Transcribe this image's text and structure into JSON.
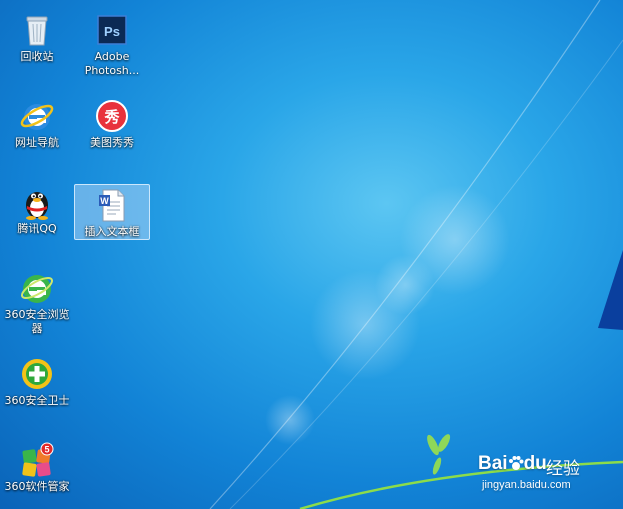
{
  "desktop": {
    "icons": [
      {
        "label": "回收站",
        "icon": "recycle-bin-icon"
      },
      {
        "label": "Adobe Photosh...",
        "icon": "photoshop-icon",
        "glyph": "Ps"
      },
      {
        "label": "网址导航",
        "icon": "internet-explorer-icon",
        "glyph": "e"
      },
      {
        "label": "美图秀秀",
        "icon": "meitu-xiuxiu-icon",
        "glyph": "秀"
      },
      {
        "label": "腾讯QQ",
        "icon": "qq-penguin-icon"
      },
      {
        "label": "插入文本框",
        "icon": "word-document-icon",
        "glyph": "W"
      },
      {
        "label": "360安全浏览器",
        "icon": "360-browser-icon",
        "glyph": "e"
      },
      {
        "label": "360安全卫士",
        "icon": "360-security-guard-icon",
        "glyph": "+"
      },
      {
        "label": "360软件管家",
        "icon": "360-software-manager-icon",
        "glyph": "5"
      }
    ]
  },
  "watermark": {
    "brand": "Bai",
    "brand_suffix": "du",
    "cn": "经验",
    "url": "jingyan.baidu.com"
  },
  "colors": {
    "wallpaper": "#1a8fdf",
    "selection": "#c8e1fa"
  }
}
